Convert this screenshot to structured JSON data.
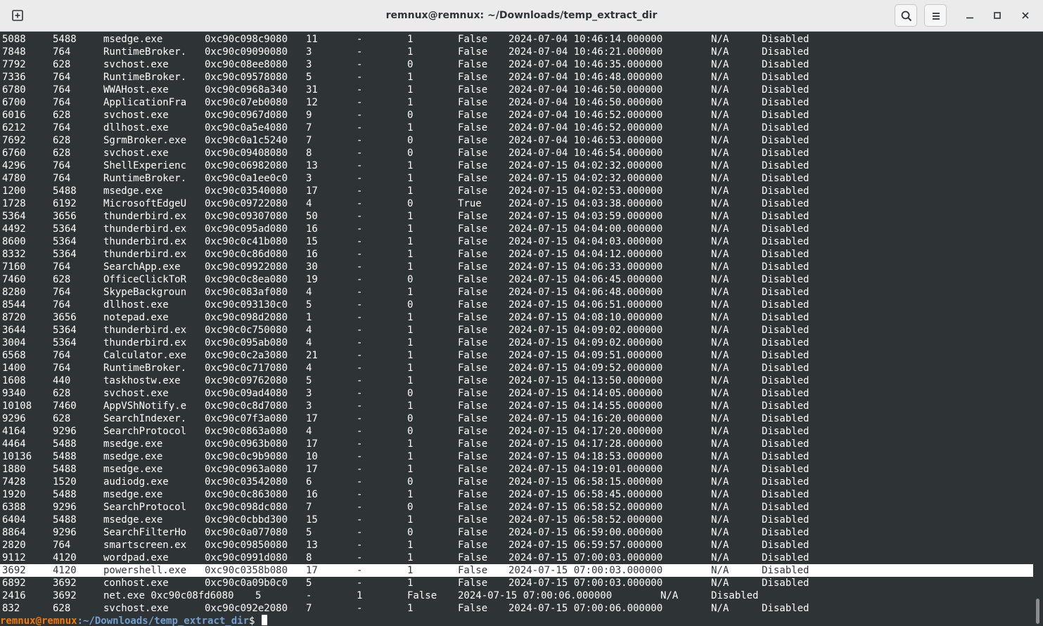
{
  "window": {
    "title": "remnux@remnux: ~/Downloads/temp_extract_dir"
  },
  "icons": {
    "new_tab": "new-tab-icon",
    "search": "search-icon",
    "menu": "hamburger-menu-icon",
    "minimize": "minimize-icon",
    "maximize": "maximize-icon",
    "close": "close-icon"
  },
  "colors": {
    "terminal_bg": "#2e3436",
    "terminal_fg": "#ffffff",
    "prompt_user": "#f57900",
    "prompt_path": "#729fcf",
    "titlebar_bg": "#ebebeb"
  },
  "rows": [
    [
      "5088",
      "5488",
      "msedge.exe",
      "0xc90c098c9080",
      "11",
      "-",
      "1",
      "False",
      "2024-07-04 10:46:14.000000",
      "N/A",
      "Disabled"
    ],
    [
      "7848",
      "764",
      "RuntimeBroker.",
      "0xc90c09090080",
      "3",
      "-",
      "1",
      "False",
      "2024-07-04 10:46:21.000000",
      "N/A",
      "Disabled"
    ],
    [
      "7792",
      "628",
      "svchost.exe",
      "0xc90c08ee8080",
      "3",
      "-",
      "0",
      "False",
      "2024-07-04 10:46:35.000000",
      "N/A",
      "Disabled"
    ],
    [
      "7336",
      "764",
      "RuntimeBroker.",
      "0xc90c09578080",
      "5",
      "-",
      "1",
      "False",
      "2024-07-04 10:46:48.000000",
      "N/A",
      "Disabled"
    ],
    [
      "6780",
      "764",
      "WWAHost.exe",
      "0xc90c0968a340",
      "31",
      "-",
      "1",
      "False",
      "2024-07-04 10:46:50.000000",
      "N/A",
      "Disabled"
    ],
    [
      "6700",
      "764",
      "ApplicationFra",
      "0xc90c07eb0080",
      "12",
      "-",
      "1",
      "False",
      "2024-07-04 10:46:50.000000",
      "N/A",
      "Disabled"
    ],
    [
      "6016",
      "628",
      "svchost.exe",
      "0xc90c0967d080",
      "9",
      "-",
      "0",
      "False",
      "2024-07-04 10:46:52.000000",
      "N/A",
      "Disabled"
    ],
    [
      "6212",
      "764",
      "dllhost.exe",
      "0xc90c0a5e4080",
      "7",
      "-",
      "1",
      "False",
      "2024-07-04 10:46:52.000000",
      "N/A",
      "Disabled"
    ],
    [
      "7692",
      "628",
      "SgrmBroker.exe",
      "0xc90c0a1c5240",
      "7",
      "-",
      "0",
      "False",
      "2024-07-04 10:46:53.000000",
      "N/A",
      "Disabled"
    ],
    [
      "6760",
      "628",
      "svchost.exe",
      "0xc90c09408080",
      "8",
      "-",
      "0",
      "False",
      "2024-07-04 10:46:54.000000",
      "N/A",
      "Disabled"
    ],
    [
      "4296",
      "764",
      "ShellExperienc",
      "0xc90c06982080",
      "13",
      "-",
      "1",
      "False",
      "2024-07-15 04:02:32.000000",
      "N/A",
      "Disabled"
    ],
    [
      "4780",
      "764",
      "RuntimeBroker.",
      "0xc90c0a1ee0c0",
      "3",
      "-",
      "1",
      "False",
      "2024-07-15 04:02:32.000000",
      "N/A",
      "Disabled"
    ],
    [
      "1200",
      "5488",
      "msedge.exe",
      "0xc90c03540080",
      "17",
      "-",
      "1",
      "False",
      "2024-07-15 04:02:53.000000",
      "N/A",
      "Disabled"
    ],
    [
      "1728",
      "6192",
      "MicrosoftEdgeU",
      "0xc90c09722080",
      "4",
      "-",
      "0",
      "True",
      "2024-07-15 04:03:38.000000",
      "N/A",
      "Disabled"
    ],
    [
      "5364",
      "3656",
      "thunderbird.ex",
      "0xc90c09307080",
      "50",
      "-",
      "1",
      "False",
      "2024-07-15 04:03:59.000000",
      "N/A",
      "Disabled"
    ],
    [
      "4492",
      "5364",
      "thunderbird.ex",
      "0xc90c095ad080",
      "16",
      "-",
      "1",
      "False",
      "2024-07-15 04:04:00.000000",
      "N/A",
      "Disabled"
    ],
    [
      "8600",
      "5364",
      "thunderbird.ex",
      "0xc90c0c41b080",
      "15",
      "-",
      "1",
      "False",
      "2024-07-15 04:04:03.000000",
      "N/A",
      "Disabled"
    ],
    [
      "8332",
      "5364",
      "thunderbird.ex",
      "0xc90c0c86d080",
      "16",
      "-",
      "1",
      "False",
      "2024-07-15 04:04:12.000000",
      "N/A",
      "Disabled"
    ],
    [
      "7160",
      "764",
      "SearchApp.exe",
      "0xc90c09922080",
      "30",
      "-",
      "1",
      "False",
      "2024-07-15 04:06:33.000000",
      "N/A",
      "Disabled"
    ],
    [
      "7460",
      "628",
      "OfficeClickToR",
      "0xc90c0c8ea080",
      "19",
      "-",
      "0",
      "False",
      "2024-07-15 04:06:45.000000",
      "N/A",
      "Disabled"
    ],
    [
      "8280",
      "764",
      "SkypeBackgroun",
      "0xc90c083af080",
      "4",
      "-",
      "1",
      "False",
      "2024-07-15 04:06:48.000000",
      "N/A",
      "Disabled"
    ],
    [
      "8544",
      "764",
      "dllhost.exe",
      "0xc90c093130c0",
      "5",
      "-",
      "0",
      "False",
      "2024-07-15 04:06:51.000000",
      "N/A",
      "Disabled"
    ],
    [
      "8720",
      "3656",
      "notepad.exe",
      "0xc90c098d2080",
      "1",
      "-",
      "1",
      "False",
      "2024-07-15 04:08:10.000000",
      "N/A",
      "Disabled"
    ],
    [
      "3644",
      "5364",
      "thunderbird.ex",
      "0xc90c0c750080",
      "4",
      "-",
      "1",
      "False",
      "2024-07-15 04:09:02.000000",
      "N/A",
      "Disabled"
    ],
    [
      "3004",
      "5364",
      "thunderbird.ex",
      "0xc90c095ab080",
      "4",
      "-",
      "1",
      "False",
      "2024-07-15 04:09:02.000000",
      "N/A",
      "Disabled"
    ],
    [
      "6568",
      "764",
      "Calculator.exe",
      "0xc90c0c2a3080",
      "21",
      "-",
      "1",
      "False",
      "2024-07-15 04:09:51.000000",
      "N/A",
      "Disabled"
    ],
    [
      "1400",
      "764",
      "RuntimeBroker.",
      "0xc90c0c717080",
      "4",
      "-",
      "1",
      "False",
      "2024-07-15 04:09:52.000000",
      "N/A",
      "Disabled"
    ],
    [
      "1608",
      "440",
      "taskhostw.exe",
      "0xc90c09762080",
      "5",
      "-",
      "1",
      "False",
      "2024-07-15 04:13:50.000000",
      "N/A",
      "Disabled"
    ],
    [
      "9340",
      "628",
      "svchost.exe",
      "0xc90c09ad4080",
      "3",
      "-",
      "0",
      "False",
      "2024-07-15 04:14:05.000000",
      "N/A",
      "Disabled"
    ],
    [
      "10108",
      "7460",
      "AppVShNotify.e",
      "0xc90c0c8d7080",
      "3",
      "-",
      "1",
      "False",
      "2024-07-15 04:14:55.000000",
      "N/A",
      "Disabled"
    ],
    [
      "9296",
      "628",
      "SearchIndexer.",
      "0xc90c07f3a080",
      "17",
      "-",
      "0",
      "False",
      "2024-07-15 04:16:20.000000",
      "N/A",
      "Disabled"
    ],
    [
      "4164",
      "9296",
      "SearchProtocol",
      "0xc90c0863a080",
      "4",
      "-",
      "0",
      "False",
      "2024-07-15 04:17:20.000000",
      "N/A",
      "Disabled"
    ],
    [
      "4464",
      "5488",
      "msedge.exe",
      "0xc90c0963b080",
      "17",
      "-",
      "1",
      "False",
      "2024-07-15 04:17:28.000000",
      "N/A",
      "Disabled"
    ],
    [
      "10136",
      "5488",
      "msedge.exe",
      "0xc90c0c9b9080",
      "10",
      "-",
      "1",
      "False",
      "2024-07-15 04:18:53.000000",
      "N/A",
      "Disabled"
    ],
    [
      "1880",
      "5488",
      "msedge.exe",
      "0xc90c0963a080",
      "17",
      "-",
      "1",
      "False",
      "2024-07-15 04:19:01.000000",
      "N/A",
      "Disabled"
    ],
    [
      "7428",
      "1520",
      "audiodg.exe",
      "0xc90c03542080",
      "6",
      "-",
      "0",
      "False",
      "2024-07-15 06:58:15.000000",
      "N/A",
      "Disabled"
    ],
    [
      "1920",
      "5488",
      "msedge.exe",
      "0xc90c0c863080",
      "16",
      "-",
      "1",
      "False",
      "2024-07-15 06:58:45.000000",
      "N/A",
      "Disabled"
    ],
    [
      "6388",
      "9296",
      "SearchProtocol",
      "0xc90c098dc080",
      "7",
      "-",
      "0",
      "False",
      "2024-07-15 06:58:52.000000",
      "N/A",
      "Disabled"
    ],
    [
      "6404",
      "5488",
      "msedge.exe",
      "0xc90c0cbbd300",
      "15",
      "-",
      "1",
      "False",
      "2024-07-15 06:58:52.000000",
      "N/A",
      "Disabled"
    ],
    [
      "8864",
      "9296",
      "SearchFilterHo",
      "0xc90c0a077080",
      "5",
      "-",
      "0",
      "False",
      "2024-07-15 06:59:00.000000",
      "N/A",
      "Disabled"
    ],
    [
      "2820",
      "764",
      "smartscreen.ex",
      "0xc90c09850080",
      "13",
      "-",
      "1",
      "False",
      "2024-07-15 06:59:57.000000",
      "N/A",
      "Disabled"
    ],
    [
      "9112",
      "4120",
      "wordpad.exe",
      "0xc90c0991d080",
      "8",
      "-",
      "1",
      "False",
      "2024-07-15 07:00:03.000000",
      "N/A",
      "Disabled"
    ],
    [
      "3692",
      "4120",
      "powershell.exe",
      "0xc90c0358b080",
      "17",
      "-",
      "1",
      "False",
      "2024-07-15 07:00:03.000000",
      "N/A",
      "Disabled"
    ],
    [
      "6892",
      "3692",
      "conhost.exe",
      "0xc90c0a09b0c0",
      "5",
      "-",
      "1",
      "False",
      "2024-07-15 07:00:03.000000",
      "N/A",
      "Disabled"
    ]
  ],
  "highlighted_row_index": 42,
  "irregular_row": {
    "pid": "2416",
    "ppid": "3692",
    "name_offset": "net.exe 0xc90c08fd6080",
    "threads": "5",
    "handles": "-",
    "session": "1",
    "wow64": "False",
    "create_time": "2024-07-15 07:00:06.000000",
    "exit_time": "N/A",
    "file_output": "Disabled"
  },
  "last_row": [
    "832",
    "628",
    "svchost.exe",
    "0xc90c092e2080",
    "7",
    "-",
    "1",
    "False",
    "2024-07-15 07:00:06.000000",
    "N/A",
    "Disabled"
  ],
  "prompt": {
    "user_host": "remnux@remnux",
    "path": ":~/Downloads/temp_extract_dir",
    "symbol": "$"
  }
}
